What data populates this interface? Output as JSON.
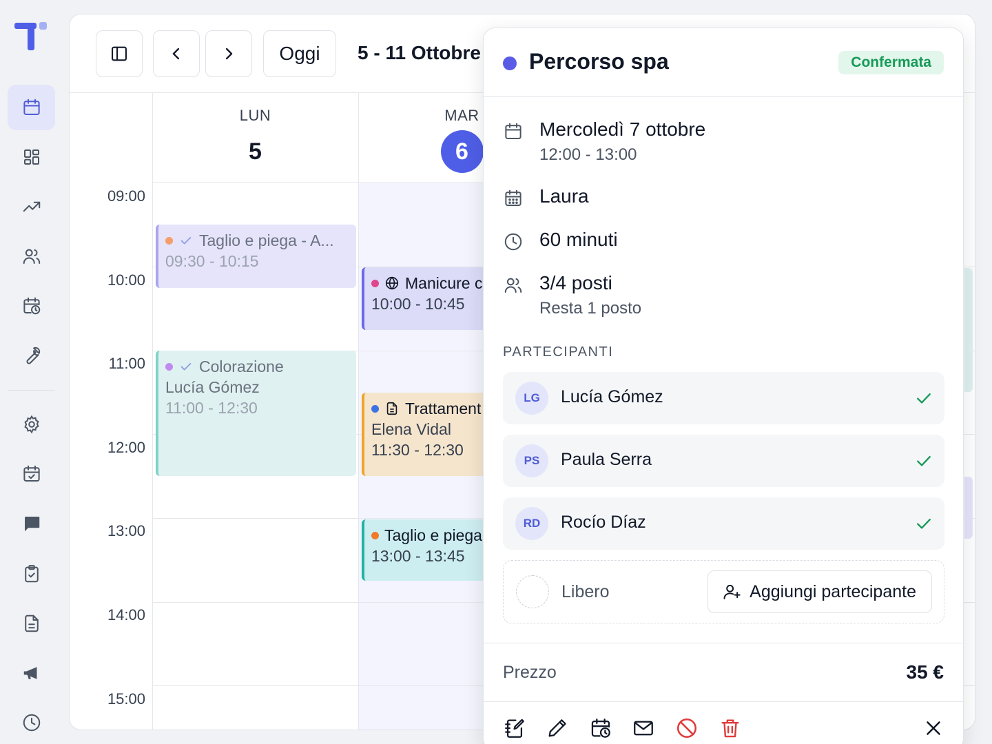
{
  "app": {
    "colors": {
      "accent": "#4f5ee6",
      "success": "#159a57",
      "danger": "#e03b3b"
    }
  },
  "sidebar": {
    "logo": "tiny-logo",
    "items": [
      {
        "icon": "calendar-icon",
        "active": true
      },
      {
        "icon": "dashboard-icon"
      },
      {
        "icon": "trending-up-icon"
      },
      {
        "icon": "users-icon"
      },
      {
        "icon": "calendar-clock-icon"
      },
      {
        "icon": "wrench-icon"
      },
      {
        "icon": "gear-icon"
      },
      {
        "icon": "calendar-check-icon"
      },
      {
        "icon": "chat-icon"
      },
      {
        "icon": "clipboard-check-icon"
      },
      {
        "icon": "document-icon"
      },
      {
        "icon": "megaphone-icon"
      },
      {
        "icon": "clock-icon"
      }
    ]
  },
  "toolbar": {
    "today_label": "Oggi",
    "range_title": "5 - 11 Ottobre"
  },
  "calendar": {
    "days": [
      {
        "name": "LUN",
        "number": "5",
        "today": false
      },
      {
        "name": "MAR",
        "number": "6",
        "today": true
      }
    ],
    "hours": [
      "09:00",
      "10:00",
      "11:00",
      "12:00",
      "13:00",
      "14:00",
      "15:00"
    ],
    "events": [
      {
        "title": "Taglio e piega - A...",
        "time": "09:30 - 10:15",
        "dot": "#f59e6b",
        "status": "check-icon"
      },
      {
        "title": "Colorazione",
        "client": "Lucía Gómez",
        "time": "11:00 - 12:30",
        "dot": "#c08af0",
        "status": "check-icon"
      },
      {
        "title": "Manicure c",
        "time": "10:00 - 10:45",
        "dot": "#e0468b",
        "status": "globe-icon"
      },
      {
        "title": "Trattament",
        "client": "Elena Vidal",
        "time": "11:30 - 12:30",
        "dot": "#3b73e6",
        "status": "document-icon"
      },
      {
        "title": "Taglio e piega",
        "time": "13:00 - 13:45",
        "dot": "#f07a2a"
      }
    ]
  },
  "detail": {
    "title": "Percorso spa",
    "status": "Confermata",
    "date": "Mercoledì 7 ottobre",
    "time": "12:00 - 13:00",
    "staff": "Laura",
    "duration": "60 minuti",
    "seats": "3/4 posti",
    "seats_left": "Resta 1 posto",
    "participants_label": "PARTECIPANTI",
    "participants": [
      {
        "initials": "LG",
        "name": "Lucía Gómez"
      },
      {
        "initials": "PS",
        "name": "Paula Serra"
      },
      {
        "initials": "RD",
        "name": "Rocío Díaz"
      }
    ],
    "free_label": "Libero",
    "add_participant_label": "Aggiungi partecipante",
    "price_label": "Prezzo",
    "price": "35 €",
    "actions": [
      "notes-icon",
      "pencil-icon",
      "reschedule-icon",
      "mail-icon",
      "cancel-icon",
      "trash-icon",
      "close-icon"
    ]
  }
}
